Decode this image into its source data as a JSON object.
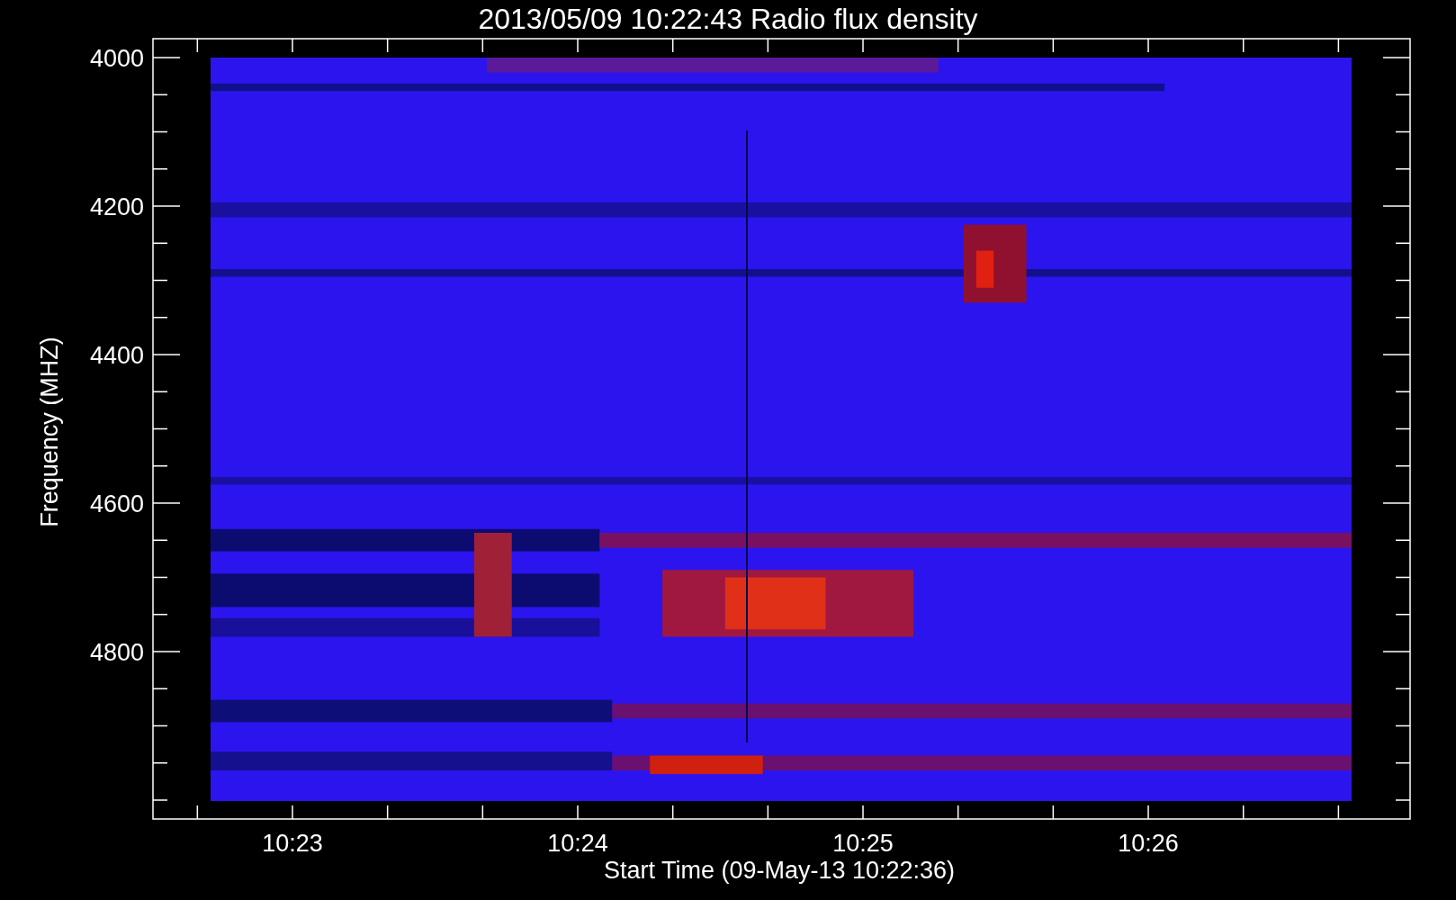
{
  "title": "2013/05/09 10:22:43 Radio flux density",
  "ylabel": "Frequency (MHZ)",
  "xlabel": "Start Time (09-May-13 10:22:36)",
  "yticks": [
    "4000",
    "4200",
    "4400",
    "4600",
    "4800"
  ],
  "xticks": [
    "10:23",
    "10:24",
    "10:25",
    "10:26"
  ]
}
